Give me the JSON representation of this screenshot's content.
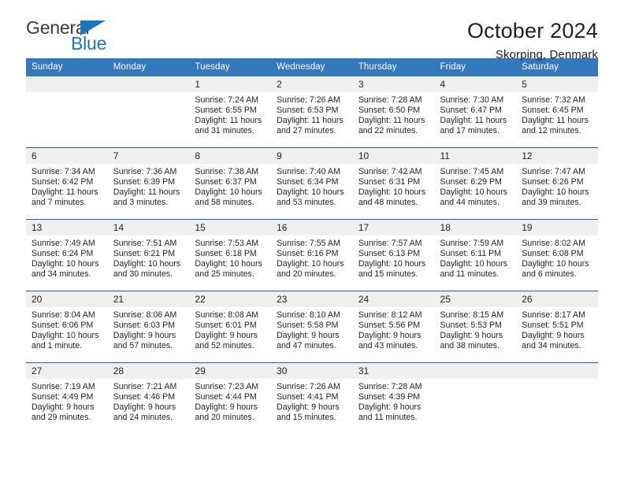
{
  "brand": {
    "name_part1": "General",
    "name_part2": "Blue",
    "accent_color": "#1c74bb"
  },
  "header": {
    "title": "October 2024",
    "subtitle": "Skorping, Denmark"
  },
  "theme": {
    "header_bg": "#3378bb",
    "row_divider": "#2a6099",
    "daynum_bg": "#efefef"
  },
  "weekday_headers": [
    "Sunday",
    "Monday",
    "Tuesday",
    "Wednesday",
    "Thursday",
    "Friday",
    "Saturday"
  ],
  "weeks": [
    [
      {
        "day": "",
        "lines": []
      },
      {
        "day": "",
        "lines": []
      },
      {
        "day": "1",
        "lines": [
          "Sunrise: 7:24 AM",
          "Sunset: 6:55 PM",
          "Daylight: 11 hours",
          "and 31 minutes."
        ]
      },
      {
        "day": "2",
        "lines": [
          "Sunrise: 7:26 AM",
          "Sunset: 6:53 PM",
          "Daylight: 11 hours",
          "and 27 minutes."
        ]
      },
      {
        "day": "3",
        "lines": [
          "Sunrise: 7:28 AM",
          "Sunset: 6:50 PM",
          "Daylight: 11 hours",
          "and 22 minutes."
        ]
      },
      {
        "day": "4",
        "lines": [
          "Sunrise: 7:30 AM",
          "Sunset: 6:47 PM",
          "Daylight: 11 hours",
          "and 17 minutes."
        ]
      },
      {
        "day": "5",
        "lines": [
          "Sunrise: 7:32 AM",
          "Sunset: 6:45 PM",
          "Daylight: 11 hours",
          "and 12 minutes."
        ]
      }
    ],
    [
      {
        "day": "6",
        "lines": [
          "Sunrise: 7:34 AM",
          "Sunset: 6:42 PM",
          "Daylight: 11 hours",
          "and 7 minutes."
        ]
      },
      {
        "day": "7",
        "lines": [
          "Sunrise: 7:36 AM",
          "Sunset: 6:39 PM",
          "Daylight: 11 hours",
          "and 3 minutes."
        ]
      },
      {
        "day": "8",
        "lines": [
          "Sunrise: 7:38 AM",
          "Sunset: 6:37 PM",
          "Daylight: 10 hours",
          "and 58 minutes."
        ]
      },
      {
        "day": "9",
        "lines": [
          "Sunrise: 7:40 AM",
          "Sunset: 6:34 PM",
          "Daylight: 10 hours",
          "and 53 minutes."
        ]
      },
      {
        "day": "10",
        "lines": [
          "Sunrise: 7:42 AM",
          "Sunset: 6:31 PM",
          "Daylight: 10 hours",
          "and 48 minutes."
        ]
      },
      {
        "day": "11",
        "lines": [
          "Sunrise: 7:45 AM",
          "Sunset: 6:29 PM",
          "Daylight: 10 hours",
          "and 44 minutes."
        ]
      },
      {
        "day": "12",
        "lines": [
          "Sunrise: 7:47 AM",
          "Sunset: 6:26 PM",
          "Daylight: 10 hours",
          "and 39 minutes."
        ]
      }
    ],
    [
      {
        "day": "13",
        "lines": [
          "Sunrise: 7:49 AM",
          "Sunset: 6:24 PM",
          "Daylight: 10 hours",
          "and 34 minutes."
        ]
      },
      {
        "day": "14",
        "lines": [
          "Sunrise: 7:51 AM",
          "Sunset: 6:21 PM",
          "Daylight: 10 hours",
          "and 30 minutes."
        ]
      },
      {
        "day": "15",
        "lines": [
          "Sunrise: 7:53 AM",
          "Sunset: 6:18 PM",
          "Daylight: 10 hours",
          "and 25 minutes."
        ]
      },
      {
        "day": "16",
        "lines": [
          "Sunrise: 7:55 AM",
          "Sunset: 6:16 PM",
          "Daylight: 10 hours",
          "and 20 minutes."
        ]
      },
      {
        "day": "17",
        "lines": [
          "Sunrise: 7:57 AM",
          "Sunset: 6:13 PM",
          "Daylight: 10 hours",
          "and 15 minutes."
        ]
      },
      {
        "day": "18",
        "lines": [
          "Sunrise: 7:59 AM",
          "Sunset: 6:11 PM",
          "Daylight: 10 hours",
          "and 11 minutes."
        ]
      },
      {
        "day": "19",
        "lines": [
          "Sunrise: 8:02 AM",
          "Sunset: 6:08 PM",
          "Daylight: 10 hours",
          "and 6 minutes."
        ]
      }
    ],
    [
      {
        "day": "20",
        "lines": [
          "Sunrise: 8:04 AM",
          "Sunset: 6:06 PM",
          "Daylight: 10 hours",
          "and 1 minute."
        ]
      },
      {
        "day": "21",
        "lines": [
          "Sunrise: 8:06 AM",
          "Sunset: 6:03 PM",
          "Daylight: 9 hours",
          "and 57 minutes."
        ]
      },
      {
        "day": "22",
        "lines": [
          "Sunrise: 8:08 AM",
          "Sunset: 6:01 PM",
          "Daylight: 9 hours",
          "and 52 minutes."
        ]
      },
      {
        "day": "23",
        "lines": [
          "Sunrise: 8:10 AM",
          "Sunset: 5:58 PM",
          "Daylight: 9 hours",
          "and 47 minutes."
        ]
      },
      {
        "day": "24",
        "lines": [
          "Sunrise: 8:12 AM",
          "Sunset: 5:56 PM",
          "Daylight: 9 hours",
          "and 43 minutes."
        ]
      },
      {
        "day": "25",
        "lines": [
          "Sunrise: 8:15 AM",
          "Sunset: 5:53 PM",
          "Daylight: 9 hours",
          "and 38 minutes."
        ]
      },
      {
        "day": "26",
        "lines": [
          "Sunrise: 8:17 AM",
          "Sunset: 5:51 PM",
          "Daylight: 9 hours",
          "and 34 minutes."
        ]
      }
    ],
    [
      {
        "day": "27",
        "lines": [
          "Sunrise: 7:19 AM",
          "Sunset: 4:49 PM",
          "Daylight: 9 hours",
          "and 29 minutes."
        ]
      },
      {
        "day": "28",
        "lines": [
          "Sunrise: 7:21 AM",
          "Sunset: 4:46 PM",
          "Daylight: 9 hours",
          "and 24 minutes."
        ]
      },
      {
        "day": "29",
        "lines": [
          "Sunrise: 7:23 AM",
          "Sunset: 4:44 PM",
          "Daylight: 9 hours",
          "and 20 minutes."
        ]
      },
      {
        "day": "30",
        "lines": [
          "Sunrise: 7:26 AM",
          "Sunset: 4:41 PM",
          "Daylight: 9 hours",
          "and 15 minutes."
        ]
      },
      {
        "day": "31",
        "lines": [
          "Sunrise: 7:28 AM",
          "Sunset: 4:39 PM",
          "Daylight: 9 hours",
          "and 11 minutes."
        ]
      },
      {
        "day": "",
        "lines": []
      },
      {
        "day": "",
        "lines": []
      }
    ]
  ]
}
